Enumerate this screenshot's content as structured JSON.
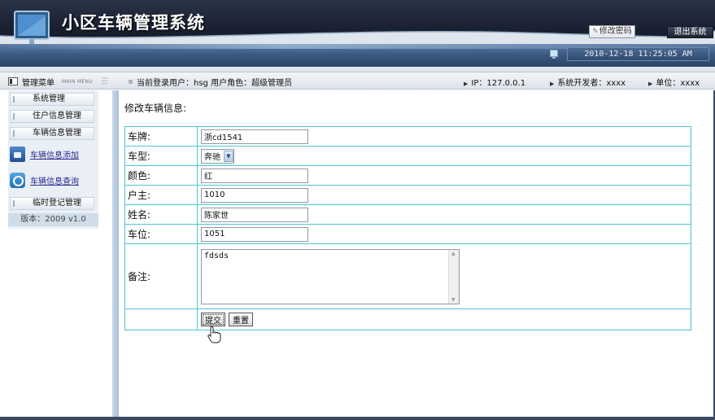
{
  "header": {
    "title": "小区车辆管理系统",
    "change_password": "修改密码",
    "logout": "退出系统",
    "datetime": "2010-12-18 11:25:05 AM"
  },
  "infobar": {
    "menu_title": "管理菜单",
    "menu_subtitle": "MAIN MENU",
    "current_user": "当前登录用户：hsg  用户角色：超级管理员",
    "ip": "IP：127.0.0.1",
    "developer": "系统开发者：xxxx",
    "unit": "单位：xxxx"
  },
  "sidebar": {
    "items": [
      {
        "label": "系统管理"
      },
      {
        "label": "住户信息管理"
      },
      {
        "label": "车辆信息管理"
      }
    ],
    "sub_items": [
      {
        "label": "车辆信息添加",
        "icon": "car-add-icon"
      },
      {
        "label": "车辆信息查询",
        "icon": "car-search-icon"
      }
    ],
    "temp_item": "临时登记管理",
    "version": "版本：2009 v1.0"
  },
  "main": {
    "page_title": "修改车辆信息:",
    "form": {
      "plate_label": "车牌:",
      "plate_value": "浙cd1541",
      "type_label": "车型:",
      "type_value": "奔驰",
      "color_label": "颜色:",
      "color_value": "红",
      "owner_label": "户主:",
      "owner_value": "1010",
      "name_label": "姓名:",
      "name_value": "陈家世",
      "space_label": "车位:",
      "space_value": "1051",
      "remark_label": "备注:",
      "remark_value": "fdsds",
      "submit_label": "提交",
      "reset_label": "重置"
    }
  },
  "colors": {
    "banner": "#1c2436",
    "strip": "#3c5a82",
    "table_border": "#4cc6d6",
    "link": "#2a2a8c"
  }
}
